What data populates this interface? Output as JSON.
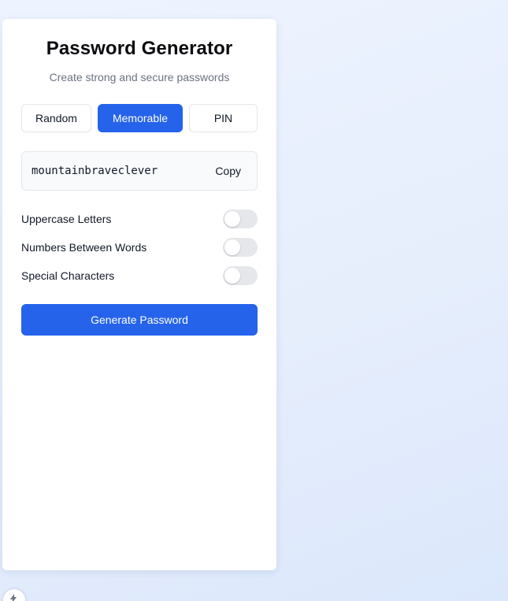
{
  "header": {
    "title": "Password Generator",
    "subtitle": "Create strong and secure passwords"
  },
  "modes": {
    "random": "Random",
    "memorable": "Memorable",
    "pin": "PIN",
    "selected": "Memorable"
  },
  "password": {
    "value": "mountainbraveclever",
    "copy_label": "Copy"
  },
  "options": [
    {
      "label": "Uppercase Letters",
      "enabled": false
    },
    {
      "label": "Numbers Between Words",
      "enabled": false
    },
    {
      "label": "Special Characters",
      "enabled": false
    }
  ],
  "actions": {
    "generate_label": "Generate Password"
  },
  "colors": {
    "accent": "#2563eb",
    "toggle_off": "#e5e7eb"
  }
}
